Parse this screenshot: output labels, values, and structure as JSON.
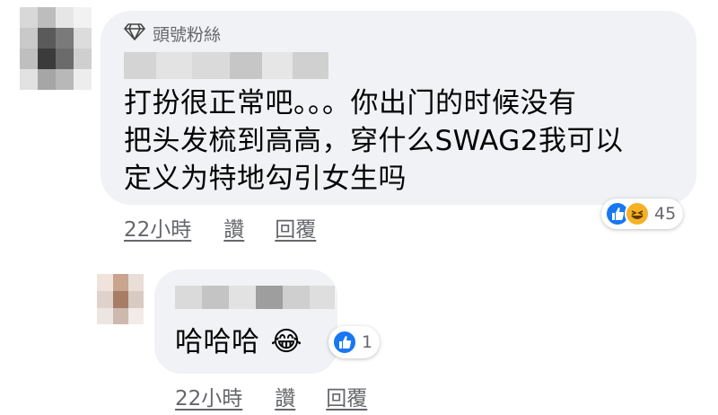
{
  "comment_main": {
    "badge": {
      "icon": "diamond-icon",
      "label": "頭號粉絲"
    },
    "text": "打扮很正常吧。。。你出门的时候没有\n把头发梳到高高，穿什么SWAG2我可以\n定义为特地勾引女生吗",
    "reactions": {
      "icons": [
        "like-icon",
        "haha-icon"
      ],
      "count": "45"
    },
    "actions": {
      "time": "22小時",
      "like": "讚",
      "reply": "回覆"
    }
  },
  "comment_reply": {
    "text": "哈哈哈",
    "emoji": "😂",
    "reactions": {
      "icons": [
        "like-icon"
      ],
      "count": "1"
    },
    "actions": {
      "time": "22小時",
      "like": "讚",
      "reply": "回覆"
    }
  },
  "colors": {
    "bubble": "#f0f2f5",
    "like_blue": "#1877f2",
    "haha_yellow": "#f7b125",
    "meta_gray": "#65676b"
  }
}
